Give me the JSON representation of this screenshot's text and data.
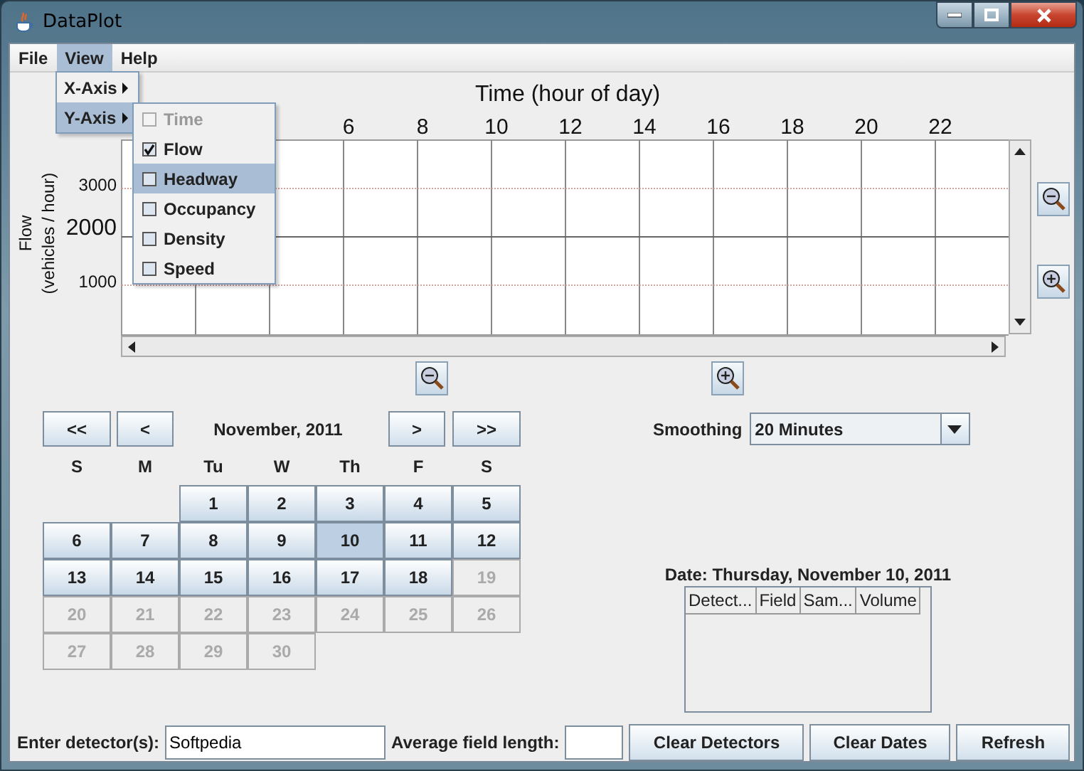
{
  "window": {
    "title": "DataPlot"
  },
  "menu_bar": [
    {
      "label": "File",
      "selected": false
    },
    {
      "label": "View",
      "selected": true
    },
    {
      "label": "Help",
      "selected": false
    }
  ],
  "view_menu": [
    {
      "label": "X-Axis",
      "selected": false
    },
    {
      "label": "Y-Axis",
      "selected": true
    }
  ],
  "y_axis_menu": [
    {
      "label": "Time",
      "checked": false,
      "disabled": true,
      "selected": false
    },
    {
      "label": "Flow",
      "checked": true,
      "disabled": false,
      "selected": false
    },
    {
      "label": "Headway",
      "checked": false,
      "disabled": false,
      "selected": true
    },
    {
      "label": "Occupancy",
      "checked": false,
      "disabled": false,
      "selected": false
    },
    {
      "label": "Density",
      "checked": false,
      "disabled": false,
      "selected": false
    },
    {
      "label": "Speed",
      "checked": false,
      "disabled": false,
      "selected": false
    }
  ],
  "plot": {
    "title": "Time (hour of day)",
    "y_title": [
      "Flow",
      "(vehicles / hour)"
    ],
    "x_ticks": [
      "6",
      "8",
      "10",
      "12",
      "14",
      "16",
      "18",
      "20",
      "22"
    ],
    "y_ticks": [
      {
        "label": "3000",
        "kind": "minor"
      },
      {
        "label": "2000",
        "kind": "major"
      },
      {
        "label": "1000",
        "kind": "minor"
      }
    ]
  },
  "calendar": {
    "prev_year": "<<",
    "prev_month": "<",
    "month": "November, 2011",
    "next_month": ">",
    "next_year": ">>",
    "weekdays": [
      "S",
      "M",
      "Tu",
      "W",
      "Th",
      "F",
      "S"
    ],
    "weeks": [
      [
        {
          "label": "1",
          "disabled": false,
          "selected": false
        },
        {
          "label": "2",
          "disabled": false,
          "selected": false
        },
        {
          "label": "3",
          "disabled": false,
          "selected": false
        },
        {
          "label": "4",
          "disabled": false,
          "selected": false
        },
        {
          "label": "5",
          "disabled": false,
          "selected": false
        }
      ],
      [
        {
          "label": "6",
          "disabled": false,
          "selected": false
        },
        {
          "label": "7",
          "disabled": false,
          "selected": false
        },
        {
          "label": "8",
          "disabled": false,
          "selected": false
        },
        {
          "label": "9",
          "disabled": false,
          "selected": false
        },
        {
          "label": "10",
          "disabled": false,
          "selected": true
        },
        {
          "label": "11",
          "disabled": false,
          "selected": false
        },
        {
          "label": "12",
          "disabled": false,
          "selected": false
        }
      ],
      [
        {
          "label": "13",
          "disabled": false,
          "selected": false
        },
        {
          "label": "14",
          "disabled": false,
          "selected": false
        },
        {
          "label": "15",
          "disabled": false,
          "selected": false
        },
        {
          "label": "16",
          "disabled": false,
          "selected": false
        },
        {
          "label": "17",
          "disabled": false,
          "selected": false
        },
        {
          "label": "18",
          "disabled": false,
          "selected": false
        },
        {
          "label": "19",
          "disabled": true,
          "selected": false
        }
      ],
      [
        {
          "label": "20",
          "disabled": true,
          "selected": false
        },
        {
          "label": "21",
          "disabled": true,
          "selected": false
        },
        {
          "label": "22",
          "disabled": true,
          "selected": false
        },
        {
          "label": "23",
          "disabled": true,
          "selected": false
        },
        {
          "label": "24",
          "disabled": true,
          "selected": false
        },
        {
          "label": "25",
          "disabled": true,
          "selected": false
        },
        {
          "label": "26",
          "disabled": true,
          "selected": false
        }
      ],
      [
        {
          "label": "27",
          "disabled": true,
          "selected": false
        },
        {
          "label": "28",
          "disabled": true,
          "selected": false
        },
        {
          "label": "29",
          "disabled": true,
          "selected": false
        },
        {
          "label": "30",
          "disabled": true,
          "selected": false
        }
      ]
    ]
  },
  "smoothing": {
    "label": "Smoothing",
    "value": "20 Minutes"
  },
  "date_label": "Date: Thursday, November 10, 2011",
  "table": {
    "columns": [
      "Detect...",
      "Field",
      "Sam...",
      "Volume"
    ]
  },
  "footer": {
    "detector_label": "Enter detector(s):",
    "detector_value": "Softpedia",
    "field_length_label": "Average field length:",
    "buttons": [
      "Clear Detectors",
      "Clear Dates",
      "Refresh"
    ]
  }
}
